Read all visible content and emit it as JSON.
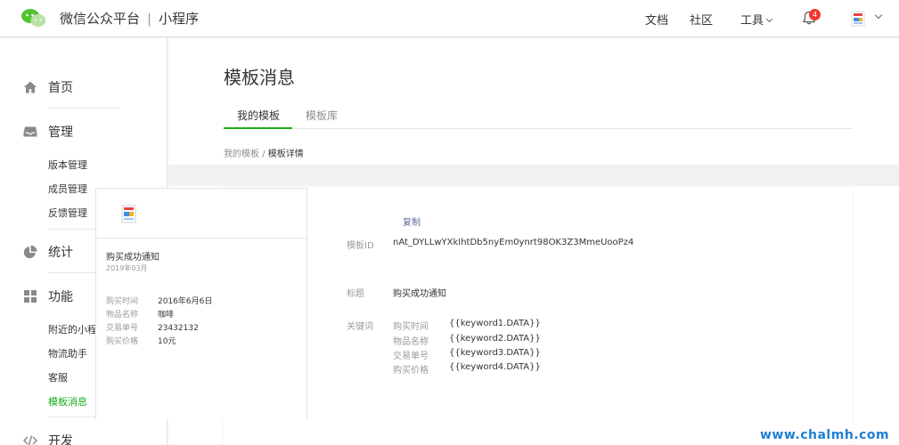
{
  "header": {
    "brand": "微信公众平台",
    "separator": "|",
    "product": "小程序",
    "nav": [
      {
        "label": "文档"
      },
      {
        "label": "社区"
      },
      {
        "label": "工具"
      }
    ],
    "notification_count": "4"
  },
  "sidebar": {
    "sections": [
      {
        "label": "首页",
        "icon": "home-icon"
      },
      {
        "label": "管理",
        "icon": "inbox-icon",
        "items": [
          "版本管理",
          "成员管理",
          "反馈管理"
        ]
      },
      {
        "label": "统计",
        "icon": "pie-chart-icon"
      },
      {
        "label": "功能",
        "icon": "grid-icon",
        "items": [
          "附近的小程序",
          "物流助手",
          "客服",
          "模板消息"
        ]
      },
      {
        "label": "开发",
        "icon": "code-icon"
      }
    ],
    "active_item": "模板消息",
    "active_color": "#1aad19"
  },
  "main": {
    "title": "模板消息",
    "tabs": [
      {
        "label": "我的模板",
        "active": true
      },
      {
        "label": "模板库",
        "active": false
      }
    ],
    "breadcrumb": {
      "parent": "我的模板",
      "separator": "/",
      "current": "模板详情"
    }
  },
  "preview_card": {
    "title": "购买成功通知",
    "date": "2019年03月",
    "rows": [
      {
        "key": "购买时间",
        "value": "2016年6月6日"
      },
      {
        "key": "物品名称",
        "value": "咖啡"
      },
      {
        "key": "交易单号",
        "value": "23432132"
      },
      {
        "key": "购买价格",
        "value": "10元"
      }
    ]
  },
  "details": {
    "template_id_label": "模板ID",
    "template_id": "nAt_DYLLwYXkIhtDb5nyEm0ynrt98OK3Z3MmeUooPz4",
    "copy_label": "复制",
    "title_label": "标题",
    "title_value": "购买成功通知",
    "keywords_label": "关键词",
    "keywords": [
      {
        "name": "购买时间",
        "value": "{{keyword1.DATA}}"
      },
      {
        "name": "物品名称",
        "value": "{{keyword2.DATA}}"
      },
      {
        "name": "交易单号",
        "value": "{{keyword3.DATA}}"
      },
      {
        "name": "购买价格",
        "value": "{{keyword4.DATA}}"
      }
    ]
  },
  "watermark": "www.chalmh.com"
}
